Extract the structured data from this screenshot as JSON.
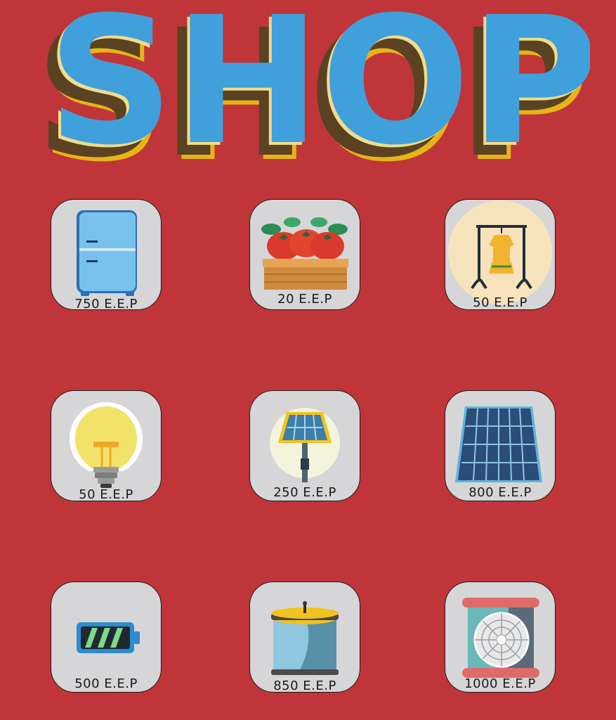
{
  "title": "SHOP",
  "colors": {
    "background": "#c03539",
    "title_fill": "#3fa0dc",
    "title_shadow": "#5a4222",
    "title_outline": "#e6b417",
    "tile_bg": "#d6d6d8"
  },
  "items": [
    {
      "icon": "fridge-icon",
      "price": "750 E.E.P"
    },
    {
      "icon": "tomato-crate-icon",
      "price": "20 E.E.P"
    },
    {
      "icon": "clothes-rack-icon",
      "price": "50 E.E.P"
    },
    {
      "icon": "light-bulb-icon",
      "price": "50 E.E.P"
    },
    {
      "icon": "solar-lamp-icon",
      "price": "250 E.E.P"
    },
    {
      "icon": "solar-panel-icon",
      "price": "800 E.E.P"
    },
    {
      "icon": "battery-icon",
      "price": "500 E.E.P"
    },
    {
      "icon": "water-tank-icon",
      "price": "850 E.E.P"
    },
    {
      "icon": "fan-icon",
      "price": "1000 E.E.P"
    }
  ]
}
